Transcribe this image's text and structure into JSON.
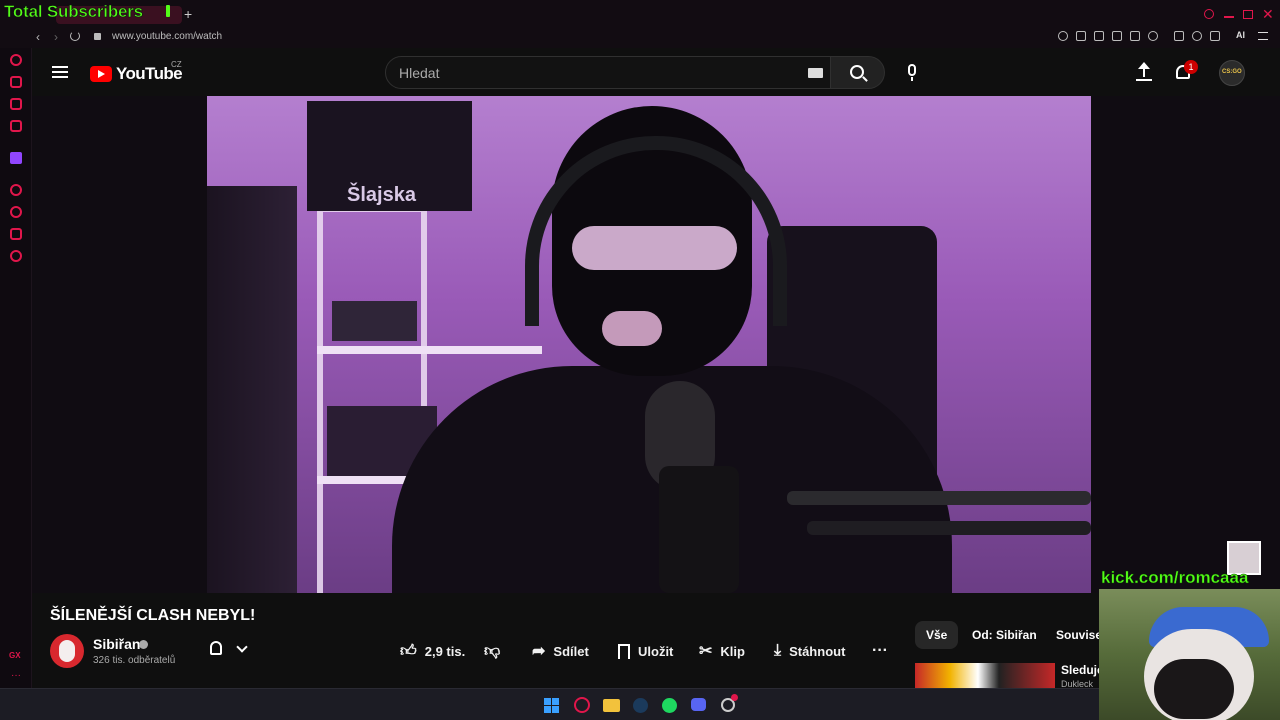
{
  "overlay": {
    "subscribers_text": "Total Subscribers"
  },
  "browser": {
    "url": "www.youtube.com/watch",
    "ai_label": "AI",
    "gx_label": "GX"
  },
  "youtube": {
    "logo_text": "YouTube",
    "region": "CZ",
    "search_placeholder": "Hledat",
    "notification_count": "1",
    "avatar_label": "CS:GO"
  },
  "video": {
    "title": "ŠÍLENĚJŠÍ CLASH NEBYL!",
    "channel_name": "Sibiřan",
    "subscribers": "326 tis. odběratelů",
    "likes": "2,9 tis.",
    "share_label": "Sdílet",
    "save_label": "Uložit",
    "clip_label": "Klip",
    "download_label": "Stáhnout",
    "poster_text": "Šlajska"
  },
  "chips": [
    "Vše",
    "Od: Sibiřan",
    "Souvisej"
  ],
  "recommended": {
    "title": "Sleduje",
    "subtitle": "Dukleck"
  },
  "stream_overlay": {
    "kick_text": "kick.com/romcaaa"
  },
  "colors": {
    "accent": "#e0164b",
    "youtube_red": "#ff0000",
    "kick_green": "#53fc18"
  }
}
